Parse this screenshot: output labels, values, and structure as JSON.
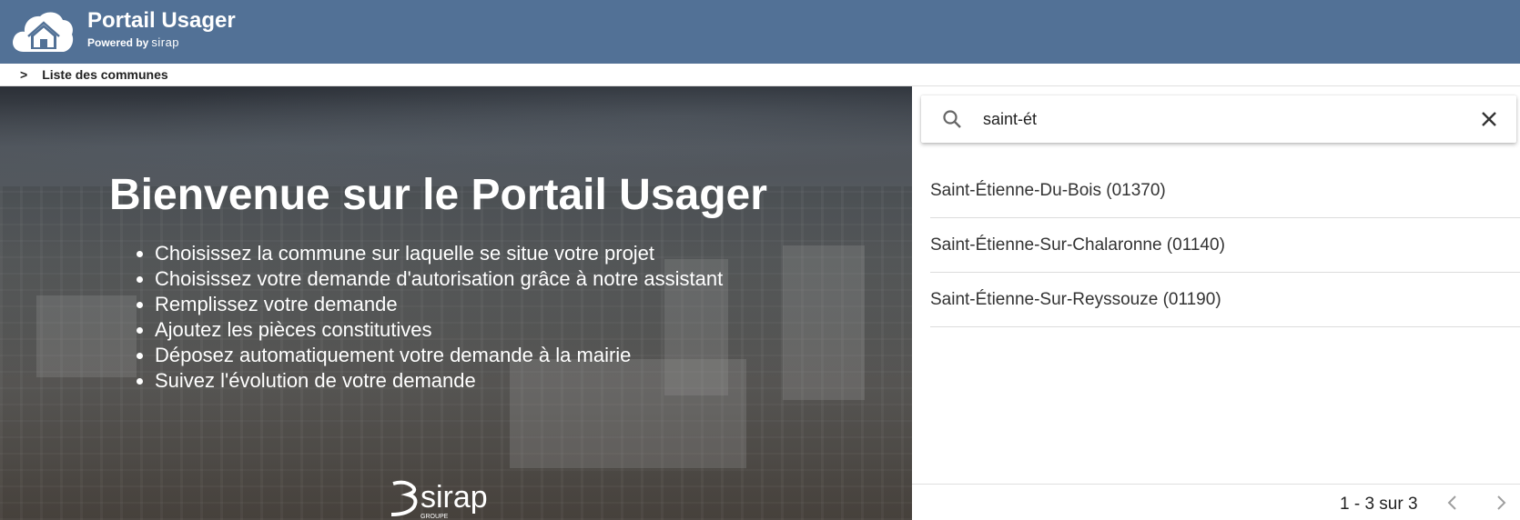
{
  "header": {
    "title": "Portail Usager",
    "powered_by": "Powered by",
    "powered_brand": "sirap"
  },
  "breadcrumb": {
    "separator": ">",
    "current": "Liste des communes"
  },
  "hero": {
    "title": "Bienvenue sur le Portail Usager",
    "steps": [
      "Choisissez la commune sur laquelle se situe votre projet",
      "Choisissez votre demande d'autorisation grâce à notre assistant",
      "Remplissez votre demande",
      "Ajoutez les pièces constitutives",
      "Déposez automatiquement votre demande à la mairie",
      "Suivez l'évolution de votre demande"
    ],
    "logo_text": "sirap",
    "logo_subtext": "GROUPE"
  },
  "search": {
    "value": "saint-ét",
    "icon": "search-icon",
    "clear_icon": "close-icon"
  },
  "results": [
    "Saint-Étienne-Du-Bois (01370)",
    "Saint-Étienne-Sur-Chalaronne (01140)",
    "Saint-Étienne-Sur-Reyssouze (01190)"
  ],
  "paginator": {
    "range_label": "1 - 3 sur 3"
  },
  "colors": {
    "header_bg": "#527196",
    "hero_overlay": "#2d3237"
  }
}
